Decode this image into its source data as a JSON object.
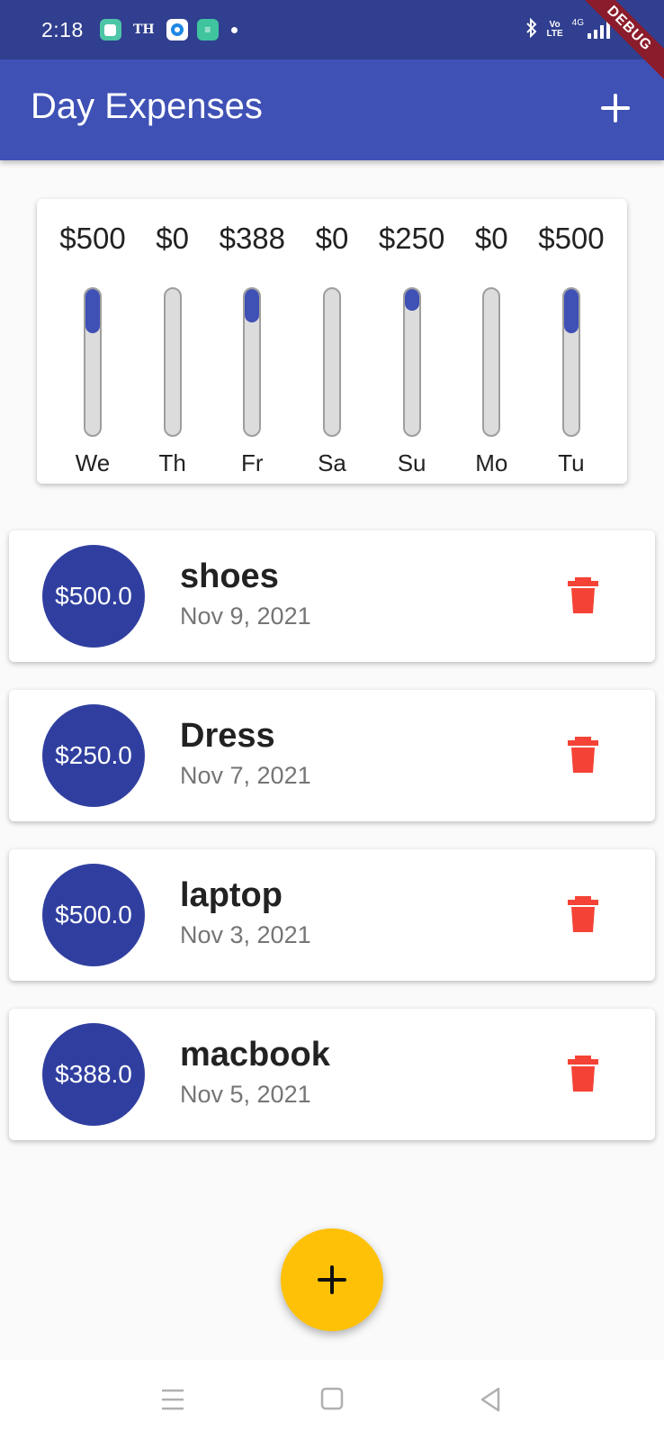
{
  "status_bar": {
    "time": "2:18",
    "notif_th": "TH",
    "volte_top": "Vo",
    "volte_bottom": "LTE",
    "network": "4G"
  },
  "debug_label": "DEBUG",
  "app_bar": {
    "title": "Day Expenses",
    "add_icon": "plus-icon"
  },
  "chart": {
    "bars": [
      {
        "amount": "$500",
        "day": "We",
        "fraction": 0.3
      },
      {
        "amount": "$0",
        "day": "Th",
        "fraction": 0.0
      },
      {
        "amount": "$388",
        "day": "Fr",
        "fraction": 0.23
      },
      {
        "amount": "$0",
        "day": "Sa",
        "fraction": 0.0
      },
      {
        "amount": "$250",
        "day": "Su",
        "fraction": 0.15
      },
      {
        "amount": "$0",
        "day": "Mo",
        "fraction": 0.0
      },
      {
        "amount": "$500",
        "day": "Tu",
        "fraction": 0.3
      }
    ],
    "fill_color": "#3f51b5"
  },
  "transactions": [
    {
      "amount": "$500.0",
      "title": "shoes",
      "date": "Nov 9, 2021"
    },
    {
      "amount": "$250.0",
      "title": "Dress",
      "date": "Nov 7, 2021"
    },
    {
      "amount": "$500.0",
      "title": "laptop",
      "date": "Nov 3, 2021"
    },
    {
      "amount": "$388.0",
      "title": "macbook",
      "date": "Nov 5, 2021"
    }
  ],
  "colors": {
    "primary": "#3f51b5",
    "avatar": "#303f9f",
    "accent": "#ffc107",
    "delete": "#f44336"
  },
  "fab_icon": "plus-icon",
  "nav": [
    "menu-icon",
    "home-icon",
    "back-icon"
  ]
}
